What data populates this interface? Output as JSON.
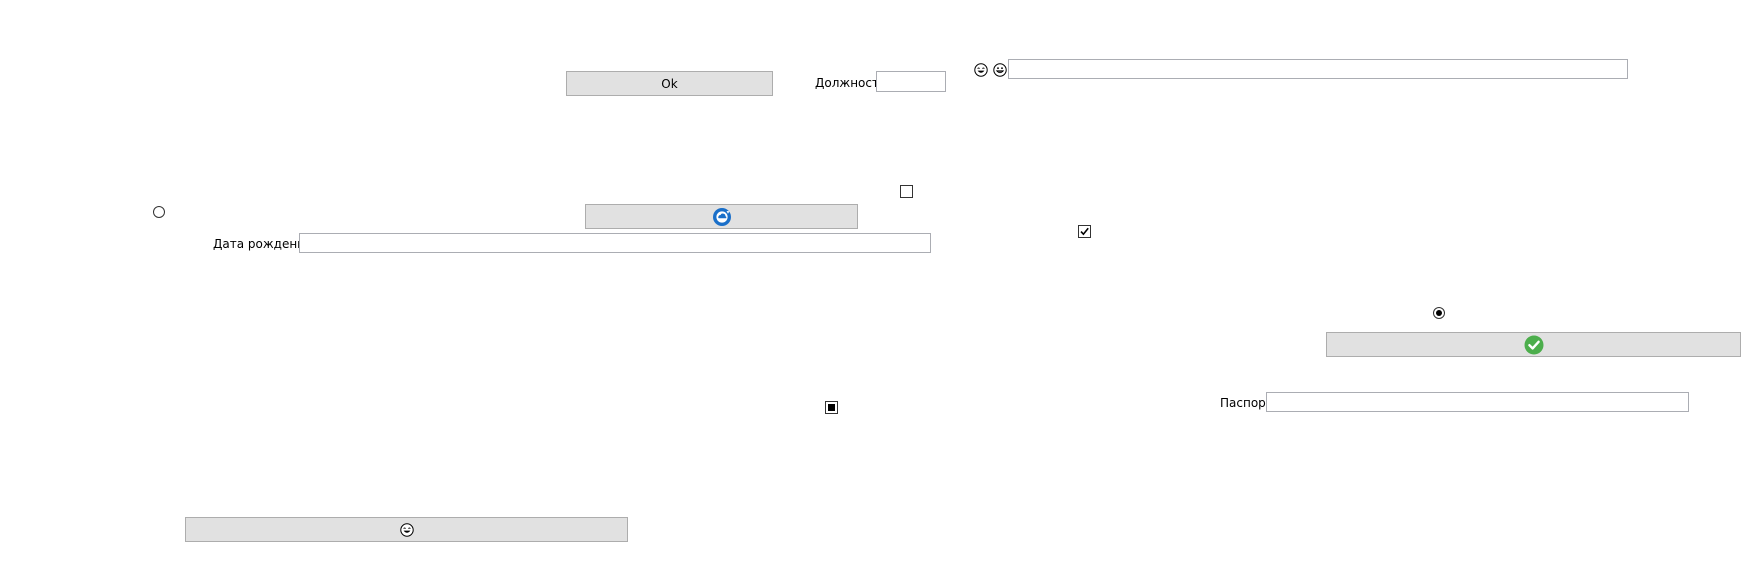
{
  "buttons": {
    "ok_label": "Ok",
    "refresh_icon": "refresh-cloud-icon",
    "confirm_icon": "green-checkmark-icon",
    "emoji_icon": "laughing-face-icon"
  },
  "fields": {
    "position_label": "Должность",
    "position_value": "",
    "birthdate_label": "Дата рождения",
    "birthdate_value": "",
    "passport_label": "Паспорт",
    "passport_value": "",
    "top_right_value": ""
  },
  "toggles": {
    "checkbox_top_checked": false,
    "checkbox_middle_checked": true,
    "checkbox_bottom_indeterminate": true,
    "radio_left_selected": false,
    "radio_right_selected": true
  },
  "icons": {
    "emoji_1": "laughing-face-icon",
    "emoji_2": "grinning-face-icon"
  },
  "colors": {
    "button_bg": "#e1e1e1",
    "button_border": "#adadad",
    "textbox_border": "#abadb3",
    "refresh_blue": "#1a6fc9",
    "check_green": "#4cae4c"
  }
}
